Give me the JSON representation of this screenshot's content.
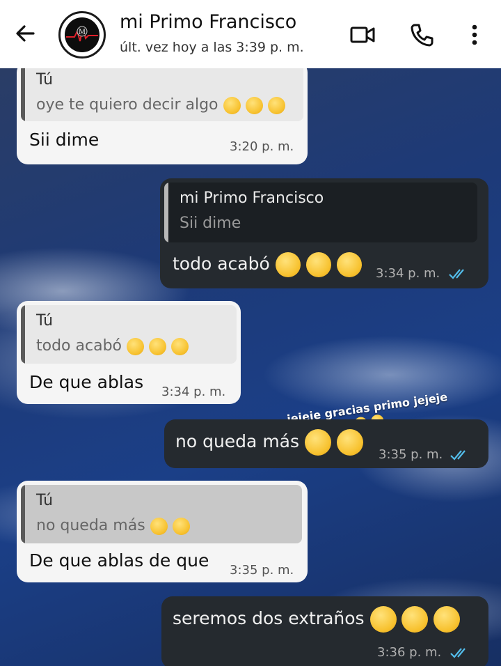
{
  "header": {
    "contact_name": "mi Primo Francisco",
    "last_seen": "últ. vez hoy a las 3:39 p. m.",
    "icons": [
      "back-arrow-icon",
      "video-call-icon",
      "voice-call-icon",
      "more-options-icon"
    ]
  },
  "overlay": {
    "text": "jejeje gracias primo jejeje"
  },
  "messages": [
    {
      "direction": "incoming",
      "quote_name": "Tú",
      "quote_text": "oye te quiero decir algo",
      "text": "Sii dime",
      "time": "3:20 p. m."
    },
    {
      "direction": "outgoing",
      "quote_name": "mi Primo Francisco",
      "quote_text": "Sii dime",
      "text": "todo acabó",
      "time": "3:34 p. m.",
      "status": "read"
    },
    {
      "direction": "incoming",
      "quote_name": "Tú",
      "quote_text": "todo acabó",
      "text": "De que ablas",
      "time": "3:34 p. m."
    },
    {
      "direction": "outgoing",
      "text": "no queda más",
      "time": "3:35 p. m.",
      "status": "read"
    },
    {
      "direction": "incoming",
      "quote_name": "Tú",
      "quote_text": "no queda más",
      "text": "De que ablas de que",
      "time": "3:35 p. m."
    },
    {
      "direction": "outgoing",
      "text": "seremos dos extraños",
      "time": "3:36 p. m.",
      "status": "read"
    }
  ],
  "colors": {
    "outgoing_bubble": "#252a2f",
    "incoming_bubble": "#f5f5f5",
    "read_ticks": "#53bdeb"
  }
}
